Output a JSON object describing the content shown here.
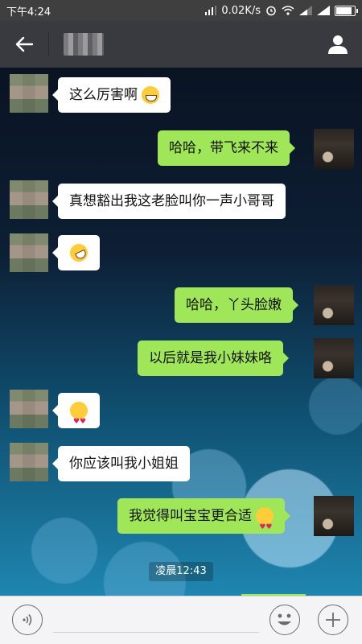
{
  "status_bar": {
    "time": "下午4:24",
    "net_speed": "0.02K/s",
    "icons": [
      "alarm-icon",
      "wifi-icon",
      "signal-icon",
      "signal-icon",
      "battery-icon"
    ]
  },
  "header": {
    "back_icon": "arrow-left-icon",
    "contact_name": "",
    "profile_icon": "person-icon"
  },
  "messages": [
    {
      "side": "left",
      "text": "这么厉害啊",
      "emoji": "laugh"
    },
    {
      "side": "right",
      "text": "哈哈，带飞来不来"
    },
    {
      "side": "left",
      "text": "真想豁出我这老脸叫你一声小哥哥"
    },
    {
      "side": "left",
      "text": "",
      "emoji": "rofl"
    },
    {
      "side": "right",
      "text": "哈哈，丫头脸嫩"
    },
    {
      "side": "right",
      "text": "以后就是我小妹妹咯"
    },
    {
      "side": "left",
      "text": "",
      "emoji": "heart-eyes"
    },
    {
      "side": "left",
      "text": "你应该叫我小姐姐"
    },
    {
      "side": "right",
      "text": "我觉得叫宝宝更合适",
      "emoji": "heart-eyes"
    }
  ],
  "timestamp": "凌晨12:43",
  "input_bar": {
    "voice_icon": "voice-icon",
    "placeholder": "",
    "emoji_icon": "smiley-icon",
    "plus_icon": "plus-icon"
  },
  "colors": {
    "header_bg": "#393a3f",
    "bubble_self": "#9fe658",
    "bubble_other": "#ffffff"
  }
}
